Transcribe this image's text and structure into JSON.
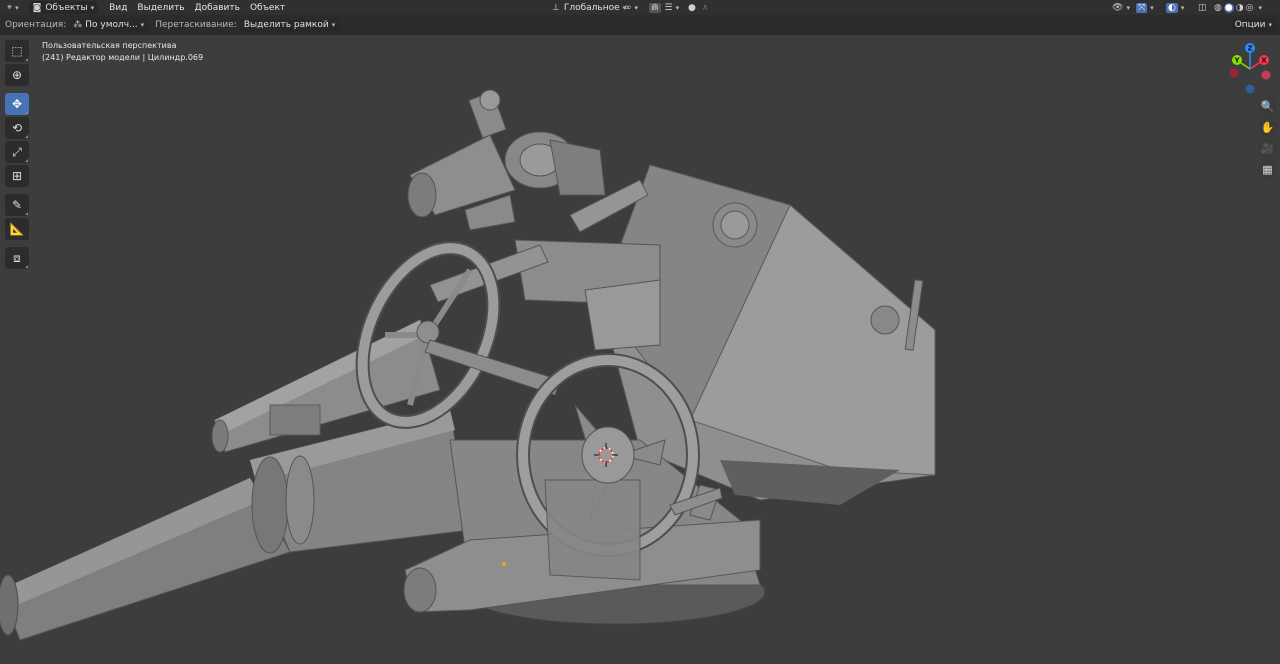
{
  "header": {
    "editor_icon": "editor-type-icon",
    "mode": "Объекты",
    "menus": [
      "Вид",
      "Выделить",
      "Добавить",
      "Объект"
    ],
    "transform_orientation": "Глобальное",
    "options_label": "Опции"
  },
  "toolsettings": {
    "orientation_label": "Ориентация:",
    "orientation_value": "По умолч...",
    "drag_label": "Перетаскивание:",
    "drag_value": "Выделить рамкой"
  },
  "viewport": {
    "view_name": "Пользовательская перспектива",
    "object_info": "(241) Редактор модели | Цилиндр.069"
  },
  "tools": [
    {
      "name": "select-box",
      "icon": "select-box-icon"
    },
    {
      "name": "cursor",
      "icon": "cursor-icon"
    },
    {
      "name": "move",
      "icon": "move-icon",
      "active": true
    },
    {
      "name": "rotate",
      "icon": "rotate-icon"
    },
    {
      "name": "scale",
      "icon": "scale-icon"
    },
    {
      "name": "transform",
      "icon": "transform-icon"
    },
    {
      "name": "annotate",
      "icon": "annotate-icon"
    },
    {
      "name": "measure",
      "icon": "measure-icon"
    },
    {
      "name": "add-cube",
      "icon": "add-cube-icon"
    }
  ],
  "gizmo": {
    "x_label": "X",
    "y_label": "Y",
    "z_label": "Z",
    "colors": {
      "x": "#ff3352",
      "y": "#8bdc00",
      "z": "#2890ff"
    }
  },
  "colors": {
    "accent": "#4772b3",
    "model": "#8a8a8a",
    "background": "#3d3d3d"
  }
}
